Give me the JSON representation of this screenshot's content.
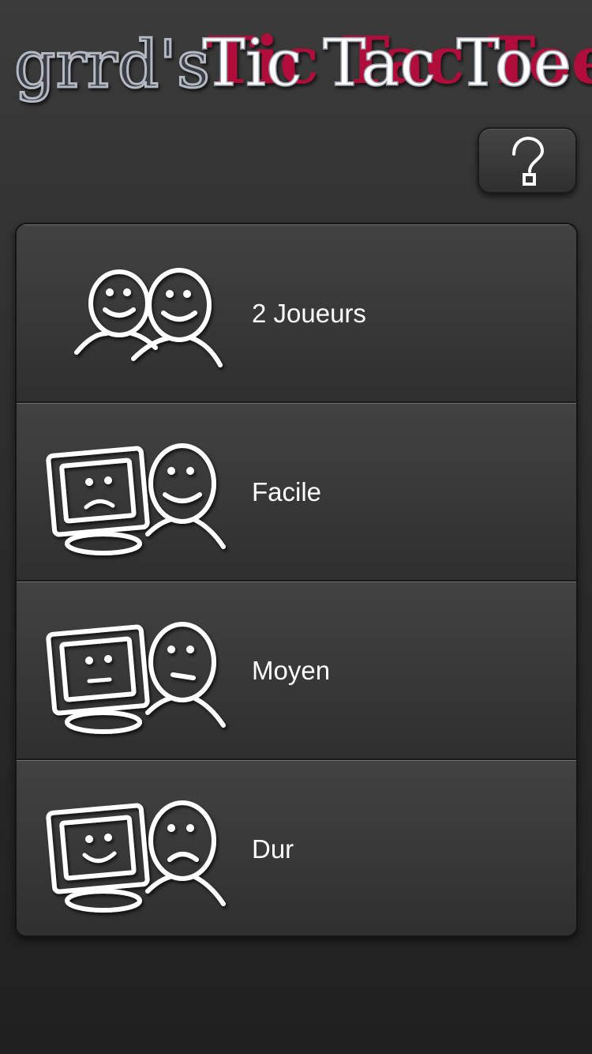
{
  "header": {
    "title_part1": "grrd's",
    "title_part2": "Tic Tac Toe"
  },
  "colors": {
    "title_gray": "#b3b8c2",
    "title_red": "#b0103a",
    "label": "#ffffff"
  },
  "help_button": {
    "icon": "question-mark-icon"
  },
  "menu": {
    "items": [
      {
        "label": "2 Joueurs",
        "icon": "two-players-icon"
      },
      {
        "label": "Facile",
        "icon": "computer-easy-icon"
      },
      {
        "label": "Moyen",
        "icon": "computer-medium-icon"
      },
      {
        "label": "Dur",
        "icon": "computer-hard-icon"
      }
    ]
  }
}
